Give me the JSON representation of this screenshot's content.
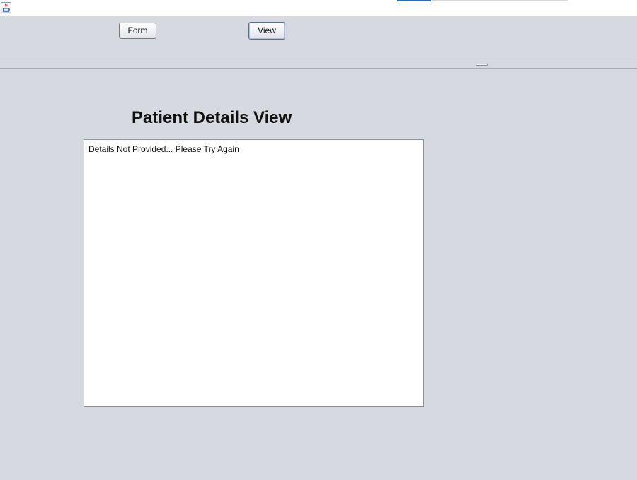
{
  "toolbar": {
    "form_label": "Form",
    "view_label": "View"
  },
  "main": {
    "title": "Patient Details View",
    "details_text": "Details Not Provided... Please Try Again"
  },
  "icons": {
    "app": "java-app-icon"
  },
  "colors": {
    "background": "#d6d9e0",
    "accent": "#1a6fc4"
  }
}
